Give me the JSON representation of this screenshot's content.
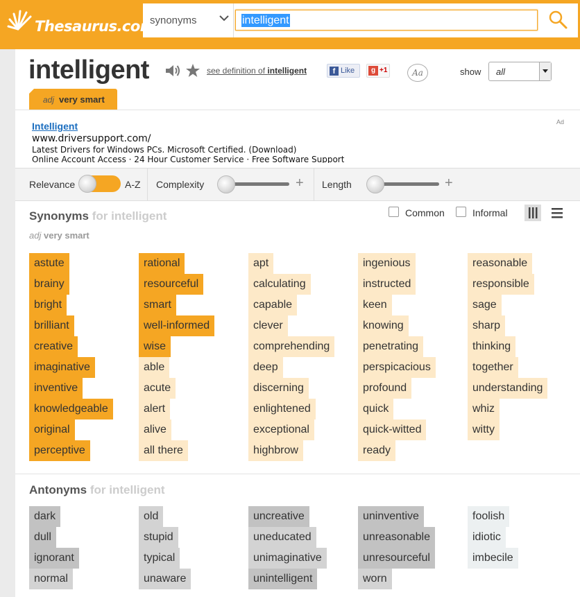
{
  "header": {
    "logo_text": "Thesaurus.com",
    "search_type": "synonyms",
    "search_value": "intelligent"
  },
  "entry": {
    "word": "intelligent",
    "see_definition_prefix": "see definition of ",
    "see_definition_word": "intelligent",
    "fb_like_label": "Like",
    "fb_icon": "f",
    "gplus_icon": "g",
    "gplus_label": "+1",
    "aa_label": "Aa",
    "show_label": "show",
    "show_value": "all",
    "pos": "adj",
    "definition": "very smart"
  },
  "ad": {
    "title": "Intelligent",
    "url": "www.driversupport.com/",
    "line1": "Latest Drivers for Windows PCs. Microsoft Certified. (Download)",
    "line2": "Online Account Access · 24 Hour Customer Service · Free Software Support",
    "badge": "Ad"
  },
  "filters": {
    "relevance_label": "Relevance",
    "az_label": "A-Z",
    "complexity_label": "Complexity",
    "length_label": "Length",
    "plus": "+"
  },
  "synonyms": {
    "title": "Synonyms",
    "title_suffix": "for intelligent",
    "pos": "adj",
    "definition": "very smart",
    "common_label": "Common",
    "informal_label": "Informal",
    "columns": [
      [
        {
          "w": "astute",
          "rel": 3
        },
        {
          "w": "brainy",
          "rel": 3
        },
        {
          "w": "bright",
          "rel": 3
        },
        {
          "w": "brilliant",
          "rel": 3
        },
        {
          "w": "creative",
          "rel": 3
        },
        {
          "w": "imaginative",
          "rel": 3
        },
        {
          "w": "inventive",
          "rel": 3
        },
        {
          "w": "knowledgeable",
          "rel": 3
        },
        {
          "w": "original",
          "rel": 3
        },
        {
          "w": "perceptive",
          "rel": 3
        }
      ],
      [
        {
          "w": "rational",
          "rel": 3
        },
        {
          "w": "resourceful",
          "rel": 3
        },
        {
          "w": "smart",
          "rel": 3
        },
        {
          "w": "well-informed",
          "rel": 3
        },
        {
          "w": "wise",
          "rel": 3
        },
        {
          "w": "able",
          "rel": 1
        },
        {
          "w": "acute",
          "rel": 1
        },
        {
          "w": "alert",
          "rel": 1
        },
        {
          "w": "alive",
          "rel": 1
        },
        {
          "w": "all there",
          "rel": 1
        }
      ],
      [
        {
          "w": "apt",
          "rel": 1
        },
        {
          "w": "calculating",
          "rel": 1
        },
        {
          "w": "capable",
          "rel": 1
        },
        {
          "w": "clever",
          "rel": 1
        },
        {
          "w": "comprehending",
          "rel": 1
        },
        {
          "w": "deep",
          "rel": 1
        },
        {
          "w": "discerning",
          "rel": 1
        },
        {
          "w": "enlightened",
          "rel": 1
        },
        {
          "w": "exceptional",
          "rel": 1
        },
        {
          "w": "highbrow",
          "rel": 1
        }
      ],
      [
        {
          "w": "ingenious",
          "rel": 1
        },
        {
          "w": "instructed",
          "rel": 1
        },
        {
          "w": "keen",
          "rel": 1
        },
        {
          "w": "knowing",
          "rel": 1
        },
        {
          "w": "penetrating",
          "rel": 1
        },
        {
          "w": "perspicacious",
          "rel": 1
        },
        {
          "w": "profound",
          "rel": 1
        },
        {
          "w": "quick",
          "rel": 1
        },
        {
          "w": "quick-witted",
          "rel": 1
        },
        {
          "w": "ready",
          "rel": 1
        }
      ],
      [
        {
          "w": "reasonable",
          "rel": 1
        },
        {
          "w": "responsible",
          "rel": 1
        },
        {
          "w": "sage",
          "rel": 1
        },
        {
          "w": "sharp",
          "rel": 1
        },
        {
          "w": "thinking",
          "rel": 1
        },
        {
          "w": "together",
          "rel": 1
        },
        {
          "w": "understanding",
          "rel": 1
        },
        {
          "w": "whiz",
          "rel": 1
        },
        {
          "w": "witty",
          "rel": 1
        }
      ]
    ]
  },
  "antonyms": {
    "title": "Antonyms",
    "title_suffix": "for intelligent",
    "columns": [
      [
        {
          "w": "dark",
          "rel": 3
        },
        {
          "w": "dull",
          "rel": 3
        },
        {
          "w": "ignorant",
          "rel": 3
        },
        {
          "w": "normal",
          "rel": 2
        }
      ],
      [
        {
          "w": "old",
          "rel": 2
        },
        {
          "w": "stupid",
          "rel": 2
        },
        {
          "w": "typical",
          "rel": 2
        },
        {
          "w": "unaware",
          "rel": 2
        }
      ],
      [
        {
          "w": "uncreative",
          "rel": 3
        },
        {
          "w": "uneducated",
          "rel": 2
        },
        {
          "w": "unimaginative",
          "rel": 2
        },
        {
          "w": "unintelligent",
          "rel": 3
        }
      ],
      [
        {
          "w": "uninventive",
          "rel": 3
        },
        {
          "w": "unreasonable",
          "rel": 3
        },
        {
          "w": "unresourceful",
          "rel": 3
        },
        {
          "w": "worn",
          "rel": 2
        }
      ],
      [
        {
          "w": "foolish",
          "rel": 1
        },
        {
          "w": "idiotic",
          "rel": 1
        },
        {
          "w": "imbecile",
          "rel": 1
        }
      ]
    ]
  },
  "colors": {
    "brand_orange": "#f5a623",
    "syn_high": "#f5a623",
    "syn_low": "#fde9c8",
    "ant_high": "#c2c2c2",
    "ant_low": "#ecf0f1"
  }
}
